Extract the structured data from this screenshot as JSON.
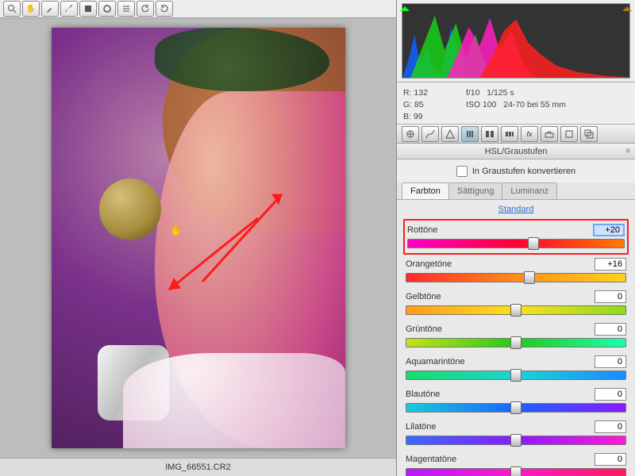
{
  "filename": "IMG_66551.CR2",
  "toolbar_icons": [
    "zoom",
    "hand",
    "eyedropper",
    "brush",
    "square",
    "circle",
    "list",
    "rotate-ccw",
    "rotate-cw"
  ],
  "metadata": {
    "r": "R:  132",
    "g": "G:   85",
    "b": "B:   99",
    "aperture": "f/10",
    "shutter": "1/125 s",
    "iso": "ISO 100",
    "lens": "24-70 bei 55 mm"
  },
  "panel_icons": [
    "aperture",
    "grid",
    "prism",
    "detail",
    "columns",
    "bars",
    "fx",
    "split",
    "crop",
    "stack"
  ],
  "panel_title": "HSL/Graustufen",
  "convert_gray": "In Graustufen konvertieren",
  "tabs": {
    "hue": "Farbton",
    "sat": "Sättigung",
    "lum": "Luminanz"
  },
  "default_link": "Standard",
  "sliders": [
    {
      "label": "Rottöne",
      "value": "+20",
      "pos": 58,
      "grad": "linear-gradient(90deg,#ff00c8,#ff0033,#ff7a00)",
      "hl": true,
      "sel": true
    },
    {
      "label": "Orangetöne",
      "value": "+16",
      "pos": 56,
      "grad": "linear-gradient(90deg,#ff2a2a,#ff8c1a,#ffd21a)"
    },
    {
      "label": "Gelbtöne",
      "value": "0",
      "pos": 50,
      "grad": "linear-gradient(90deg,#ff9a1a,#ffe01a,#8bdc1a)"
    },
    {
      "label": "Grüntöne",
      "value": "0",
      "pos": 50,
      "grad": "linear-gradient(90deg,#c7e01a,#25c91a,#1affb0)"
    },
    {
      "label": "Aquamarintöne",
      "value": "0",
      "pos": 50,
      "grad": "linear-gradient(90deg,#1adc6a,#1ad4d4,#1a8aff)"
    },
    {
      "label": "Blautöne",
      "value": "0",
      "pos": 50,
      "grad": "linear-gradient(90deg,#1acbdc,#1a62ff,#8a1aff)"
    },
    {
      "label": "Lilatöne",
      "value": "0",
      "pos": 50,
      "grad": "linear-gradient(90deg,#3a6aff,#8a1aff,#ff1ad4)"
    },
    {
      "label": "Magentatöne",
      "value": "0",
      "pos": 50,
      "grad": "linear-gradient(90deg,#b41aff,#ff1ac8,#ff1a62)"
    }
  ],
  "hist_warn": {
    "shadow": "#0aff16",
    "highlight": "#a57a1a"
  }
}
